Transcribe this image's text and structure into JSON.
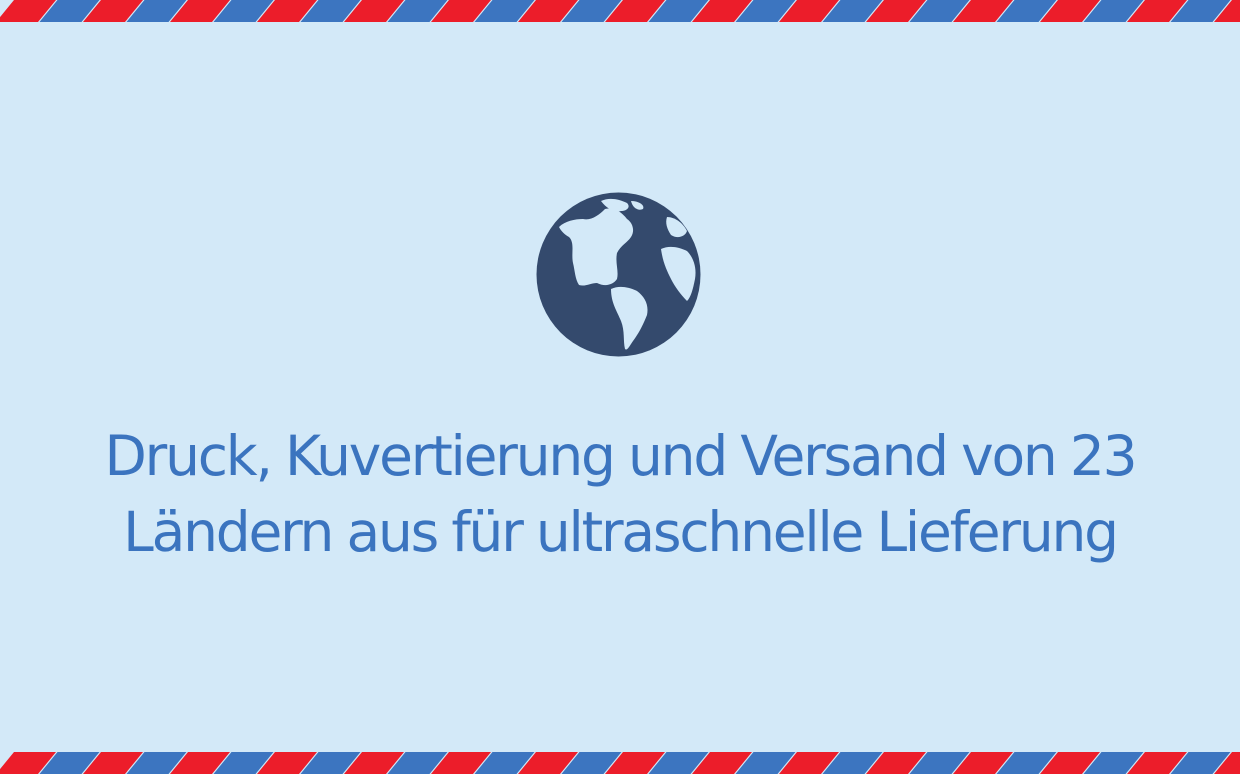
{
  "colors": {
    "background": "#d3e9f8",
    "stripe_red": "#ec1d2a",
    "stripe_blue": "#3c75c0",
    "globe": "#344a6d",
    "text": "#3b74bf"
  },
  "border_pattern": {
    "top": "airmail-stripes",
    "bottom": "airmail-stripes"
  },
  "icon": {
    "name": "globe-icon"
  },
  "headline": {
    "line1": "Druck, Kuvertierung und Versand von 23",
    "line2": "Ländern aus für ultraschnelle Lieferung"
  }
}
